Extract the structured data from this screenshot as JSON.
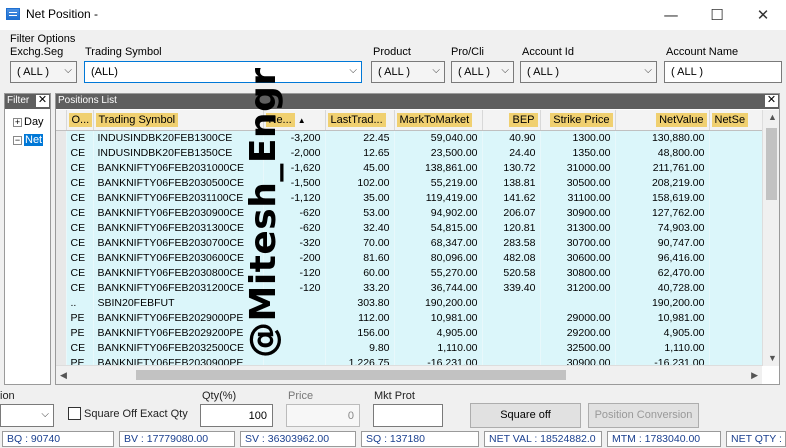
{
  "window": {
    "title": "Net Position -",
    "minimize": "—",
    "maximize": "☐",
    "close": "✕"
  },
  "filter": {
    "section_title": "Filter Options",
    "labels": {
      "exch_seg": "Exchg.Seg",
      "trading_symbol": "Trading Symbol",
      "product": "Product",
      "pro_cli": "Pro/Cli",
      "account_id": "Account Id",
      "account_name": "Account Name"
    },
    "values": {
      "exch_seg": "( ALL )",
      "trading_symbol": "(ALL)",
      "product": "( ALL )",
      "pro_cli": "( ALL )",
      "account_id": "( ALL )",
      "account_name": "( ALL )"
    }
  },
  "left_panel": {
    "header": "Filter",
    "items": [
      "Day",
      "Net"
    ]
  },
  "positions": {
    "header": "Positions List",
    "columns": [
      "O...",
      "Trading Symbol",
      "Ne...",
      "LastTrad...",
      "MarkToMarket",
      "BEP",
      "Strike Price",
      "NetValue",
      "NetSe"
    ],
    "rows": [
      [
        "CE",
        "INDUSINDBK20FEB1300CE",
        "-3,200",
        "22.45",
        "59,040.00",
        "40.90",
        "1300.00",
        "130,880.00",
        "130,"
      ],
      [
        "CE",
        "INDUSINDBK20FEB1350CE",
        "-2,000",
        "12.65",
        "23,500.00",
        "24.40",
        "1350.00",
        "48,800.00",
        "48,"
      ],
      [
        "CE",
        "BANKNIFTY06FEB2031000CE",
        "-1,620",
        "45.00",
        "138,861.00",
        "130.72",
        "31000.00",
        "211,761.00",
        "211,"
      ],
      [
        "CE",
        "BANKNIFTY06FEB2030500CE",
        "-1,500",
        "102.00",
        "55,219.00",
        "138.81",
        "30500.00",
        "208,219.00",
        "225,"
      ],
      [
        "CE",
        "BANKNIFTY06FEB2031100CE",
        "-1,120",
        "35.00",
        "119,419.00",
        "141.62",
        "31100.00",
        "158,619.00",
        "158,"
      ],
      [
        "CE",
        "BANKNIFTY06FEB2030900CE",
        "-620",
        "53.00",
        "94,902.00",
        "206.07",
        "30900.00",
        "127,762.00",
        "127,"
      ],
      [
        "CE",
        "BANKNIFTY06FEB2031300CE",
        "-620",
        "32.40",
        "54,815.00",
        "120.81",
        "31300.00",
        "74,903.00",
        "74,"
      ],
      [
        "CE",
        "BANKNIFTY06FEB2030700CE",
        "-320",
        "70.00",
        "68,347.00",
        "283.58",
        "30700.00",
        "90,747.00",
        "90,"
      ],
      [
        "CE",
        "BANKNIFTY06FEB2030600CE",
        "-200",
        "81.60",
        "80,096.00",
        "482.08",
        "30600.00",
        "96,416.00",
        "157,"
      ],
      [
        "CE",
        "BANKNIFTY06FEB2030800CE",
        "-120",
        "60.00",
        "55,270.00",
        "520.58",
        "30800.00",
        "62,470.00",
        "62,"
      ],
      [
        "CE",
        "BANKNIFTY06FEB2031200CE",
        "-120",
        "33.20",
        "36,744.00",
        "339.40",
        "31200.00",
        "40,728.00",
        "40,"
      ],
      [
        "..",
        "SBIN20FEBFUT",
        "",
        "303.80",
        "190,200.00",
        "",
        "",
        "190,200.00",
        "7,381,"
      ],
      [
        "PE",
        "BANKNIFTY06FEB2029000PE",
        "",
        "112.00",
        "10,981.00",
        "",
        "29000.00",
        "10,981.00",
        "32,"
      ],
      [
        "PE",
        "BANKNIFTY06FEB2029200PE",
        "",
        "156.00",
        "4,905.00",
        "",
        "29200.00",
        "4,905.00",
        "73,"
      ],
      [
        "CE",
        "BANKNIFTY06FEB2032500CE",
        "",
        "9.80",
        "1,110.00",
        "",
        "32500.00",
        "1,110.00",
        "1,"
      ],
      [
        "PE",
        "BANKNIFTY06FEB2030900PE",
        "",
        "1,226.75",
        "-16,231.00",
        "",
        "30900.00",
        "-16,231.00",
        "20,"
      ]
    ]
  },
  "watermark": "@Mitesh_Engr",
  "bottom": {
    "partial_label": "ion",
    "square_off_exact_qty": "Square Off Exact Qty",
    "qty_label": "Qty(%)",
    "qty_value": "100",
    "price_label": "Price",
    "price_value": "0",
    "mkt_prot_label": "Mkt Prot",
    "mkt_prot_value": "",
    "square_off_button": "Square off",
    "position_conversion_button": "Position Conversion"
  },
  "status": {
    "bq": "BQ : 90740",
    "bv": "BV : 17779080.00",
    "sv": "SV : 36303962.00",
    "sq": "SQ : 137180",
    "net_val": "NET VAL : 18524882.0",
    "mtm": "MTM : 1783040.00",
    "net_qty": "NET QTY :"
  },
  "colors": {
    "row_bg": "#dbf6fa",
    "header_highlight": "#f0d070",
    "panel_header": "#5f5f5f",
    "status_text": "#1a3f8f",
    "focus_border": "#0078d7"
  }
}
